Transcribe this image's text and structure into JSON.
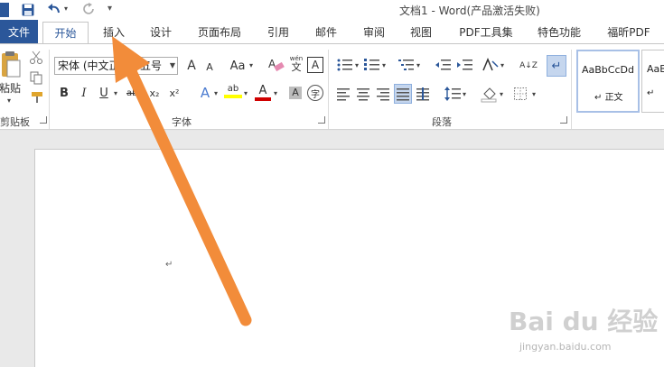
{
  "window": {
    "title": "文档1 - Word(产品激活失败)"
  },
  "tabs": [
    {
      "label": "文件"
    },
    {
      "label": "开始"
    },
    {
      "label": "插入"
    },
    {
      "label": "设计"
    },
    {
      "label": "页面布局"
    },
    {
      "label": "引用"
    },
    {
      "label": "邮件"
    },
    {
      "label": "审阅"
    },
    {
      "label": "视图"
    },
    {
      "label": "PDF工具集"
    },
    {
      "label": "特色功能"
    },
    {
      "label": "福昕PDF"
    }
  ],
  "clipboard": {
    "paste_label": "粘贴",
    "group_label": "剪贴板"
  },
  "font": {
    "name": "宋体 (中文正",
    "size": "五号",
    "group_label": "字体",
    "grow_label": "A",
    "shrink_label": "A",
    "case_label": "Aa",
    "phonetic_top": "wén",
    "phonetic_bottom": "文",
    "border_char": "A",
    "bold": "B",
    "italic": "I",
    "underline": "U",
    "strike": "abc",
    "subscript": "x₂",
    "superscript": "x²",
    "effects": "A",
    "highlight": "ab",
    "color": "A",
    "enclose": "字"
  },
  "paragraph": {
    "group_label": "段落",
    "sort_label": "A↓Z"
  },
  "styles": [
    {
      "sample": "AaBbCcDd",
      "name": "正文"
    },
    {
      "sample": "AaB",
      "name": ""
    }
  ],
  "watermark": {
    "text": "Bai du 经验",
    "sub": "jingyan.baidu.com"
  },
  "colors": {
    "accent": "#2b579a",
    "arrow": "#f28c3a",
    "highlight": "#ffff00",
    "font_color": "#d00000"
  }
}
